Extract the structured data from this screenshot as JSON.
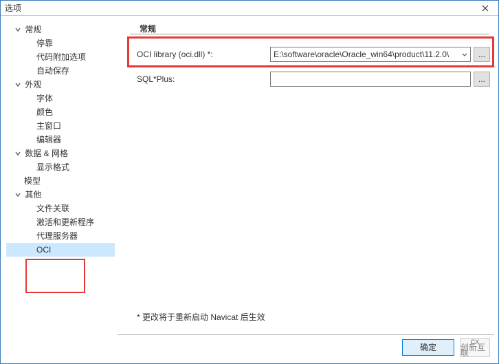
{
  "window": {
    "title": "选项"
  },
  "tree": {
    "n0": "常规",
    "n0_0": "停靠",
    "n0_1": "代码附加选项",
    "n0_2": "自动保存",
    "n1": "外观",
    "n1_0": "字体",
    "n1_1": "颜色",
    "n1_2": "主窗口",
    "n1_3": "编辑器",
    "n2": "数据 & 网格",
    "n2_0": "显示格式",
    "n3": "模型",
    "n4": "其他",
    "n4_0": "文件关联",
    "n4_1": "激活和更新程序",
    "n4_2": "代理服务器",
    "n4_3": "OCI"
  },
  "main": {
    "section": "常规",
    "row1_label": "OCI library (oci.dll) *:",
    "row1_value": "E:\\software\\oracle\\Oracle_win64\\product\\11.2.0\\",
    "row2_label": "SQL*Plus:",
    "row2_value": "",
    "browse": "...",
    "footnote": "* 更改将于重新启动 Navicat 后生效"
  },
  "footer": {
    "ok": "确定",
    "logo1": "CX",
    "logo2": "创新互联"
  }
}
